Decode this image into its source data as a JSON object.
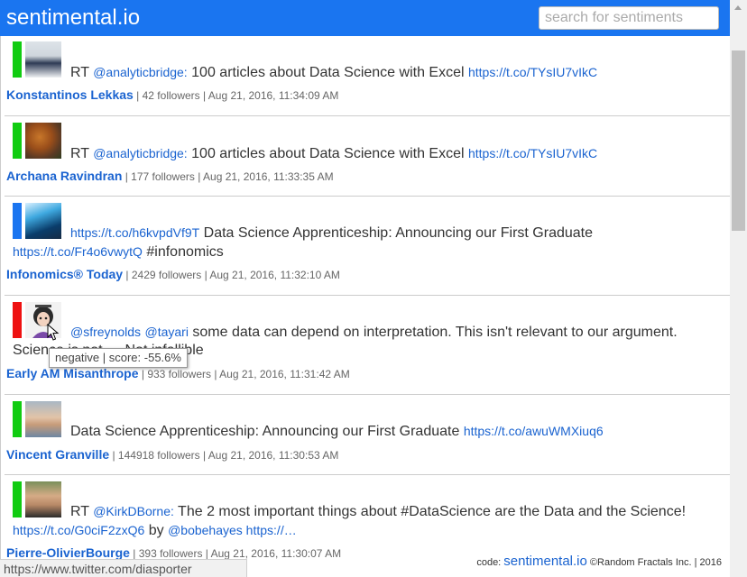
{
  "header": {
    "brand": "sentimental.io",
    "search_placeholder": "search for sentiments"
  },
  "tweets": [
    {
      "sentiment": "positive",
      "parts": [
        "RT ",
        "@analyticbridge:",
        " 100 articles about Data Science with Excel ",
        "https://t.co/TYsIU7vIkC"
      ],
      "author": "Konstantinos Lekkas",
      "followers": "42 followers",
      "time": "Aug 21, 2016, 11:34:09 AM"
    },
    {
      "sentiment": "positive",
      "parts": [
        "RT ",
        "@analyticbridge:",
        " 100 articles about Data Science with Excel ",
        "https://t.co/TYsIU7vIkC"
      ],
      "author": "Archana Ravindran",
      "followers": "177 followers",
      "time": "Aug 21, 2016, 11:33:35 AM"
    },
    {
      "sentiment": "neutral",
      "parts": [
        "https://t.co/h6kvpdVf9T",
        " Data Science Apprenticeship: Announcing our First Graduate ",
        "https://t.co/Fr4o6vwytQ",
        " #infonomics"
      ],
      "author": "Infonomics® Today",
      "followers": "2429 followers",
      "time": "Aug 21, 2016, 11:32:10 AM"
    },
    {
      "sentiment": "negative",
      "parts": [
        "@sfreynolds",
        " ",
        "@tayari",
        " some data can depend on interpretation. This isn't relevant to our argument. Science is not…. Not infallible"
      ],
      "author": "Early AM Misanthrope",
      "followers": "933 followers",
      "time": "Aug 21, 2016, 11:31:42 AM"
    },
    {
      "sentiment": "positive",
      "parts": [
        "Data Science Apprenticeship: Announcing our First Graduate ",
        "https://t.co/awuWMXiuq6"
      ],
      "author": "Vincent Granville",
      "followers": "144918 followers",
      "time": "Aug 21, 2016, 11:30:53 AM"
    },
    {
      "sentiment": "positive",
      "parts": [
        "RT ",
        "@KirkDBorne:",
        " The 2 most important things about #DataScience are the Data and the Science! ",
        "https://t.co/G0ciF2zxQ6",
        " by ",
        "@bobehayes",
        " https://…"
      ],
      "author": "Pierre-OlivierBourge",
      "followers": "393 followers",
      "time": "Aug 21, 2016, 11:30:07 AM"
    }
  ],
  "tooltip": "negative | score: -55.6%",
  "footer": {
    "prefix": "code: ",
    "link": "sentimental.io",
    "suffix": " ©Random Fractals Inc. | 2016"
  },
  "status_url": "https://www.twitter.com/diasporter",
  "colors": {
    "header_bg": "#1a75f0",
    "positive": "#11cc11",
    "neutral": "#1a75f0",
    "negative": "#ee1111",
    "link": "#1a63d0"
  }
}
